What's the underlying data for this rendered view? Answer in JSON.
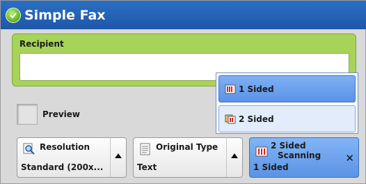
{
  "title": "Simple Fax",
  "recipient": {
    "label": "Recipient",
    "value": ""
  },
  "preview": {
    "label": "Preview",
    "checked": false
  },
  "scanning_popup": {
    "options": [
      {
        "label": "1 Sided",
        "selected": true
      },
      {
        "label": "2 Sided",
        "selected": false
      }
    ]
  },
  "buttons": {
    "resolution": {
      "title": "Resolution",
      "value": "Standard (200x..."
    },
    "original_type": {
      "title": "Original Type",
      "value": "Text"
    },
    "two_sided": {
      "title_line1": "2 Sided",
      "title_line2": "Scanning",
      "value": "1 Sided"
    }
  },
  "colors": {
    "title_bar": "#2a6fc4",
    "recipient_panel": "#a8d35a",
    "selected_blue": "#5b92e6"
  }
}
